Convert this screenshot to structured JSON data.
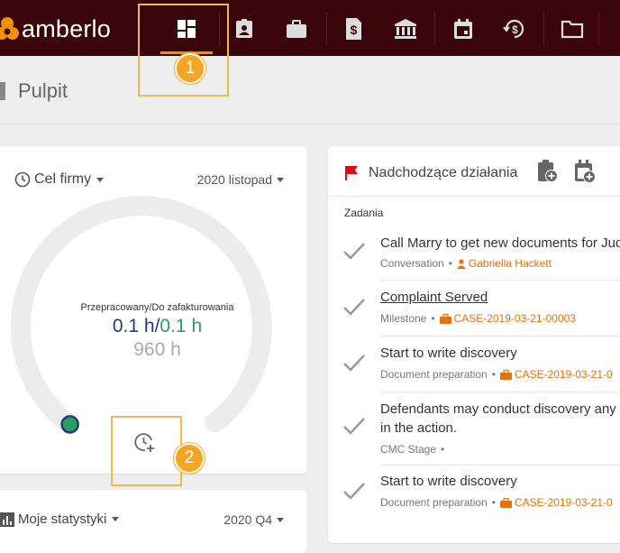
{
  "app": {
    "logo_text": "amberlo",
    "brand_color": "#f29100",
    "topbar_color": "#3a0508"
  },
  "nav": [
    {
      "icon": "dashboard-icon",
      "active": true
    },
    {
      "icon": "contact-card-icon"
    },
    {
      "icon": "briefcase-icon"
    },
    {
      "icon": "invoice-dollar-icon"
    },
    {
      "icon": "bank-icon"
    },
    {
      "icon": "calendar-icon"
    },
    {
      "icon": "time-money-icon"
    },
    {
      "icon": "folder-icon"
    }
  ],
  "page": {
    "title": "Pulpit"
  },
  "goal_card": {
    "title": "Cel firmy",
    "period": "2020 listopad",
    "label": "Przepracowany/Do zafakturowania",
    "worked": "0.1 h",
    "separator": "/",
    "to_invoice": "0.1 h",
    "target": "960 h",
    "progress_fraction": 0.0
  },
  "stats_card": {
    "title": "Moje statystyki",
    "period": "2020 Q4"
  },
  "actions_card": {
    "title": "Nadchodzące działania",
    "section": "Zadania",
    "tasks": [
      {
        "title": "Call Marry to get new documents for Jud",
        "type": "Conversation",
        "ref": "Gabriella Hackett",
        "ref_icon": "person-icon"
      },
      {
        "title": "Complaint Served",
        "type": "Milestone",
        "ref": "CASE-2019-03-21-00003",
        "ref_icon": "briefcase-icon"
      },
      {
        "title": "Start to write discovery",
        "type": "Document preparation",
        "ref": "CASE-2019-03-21-0",
        "ref_icon": "briefcase-icon"
      },
      {
        "title_line1": "Defendants may conduct discovery any",
        "title_line2": "in the action.",
        "type": "CMC Stage",
        "ref": ""
      },
      {
        "title": "Start to write discovery",
        "type": "Document preparation",
        "ref": "CASE-2019-03-21-0",
        "ref_icon": "briefcase-icon"
      }
    ]
  },
  "callouts": {
    "badge1": "1",
    "badge2": "2"
  }
}
